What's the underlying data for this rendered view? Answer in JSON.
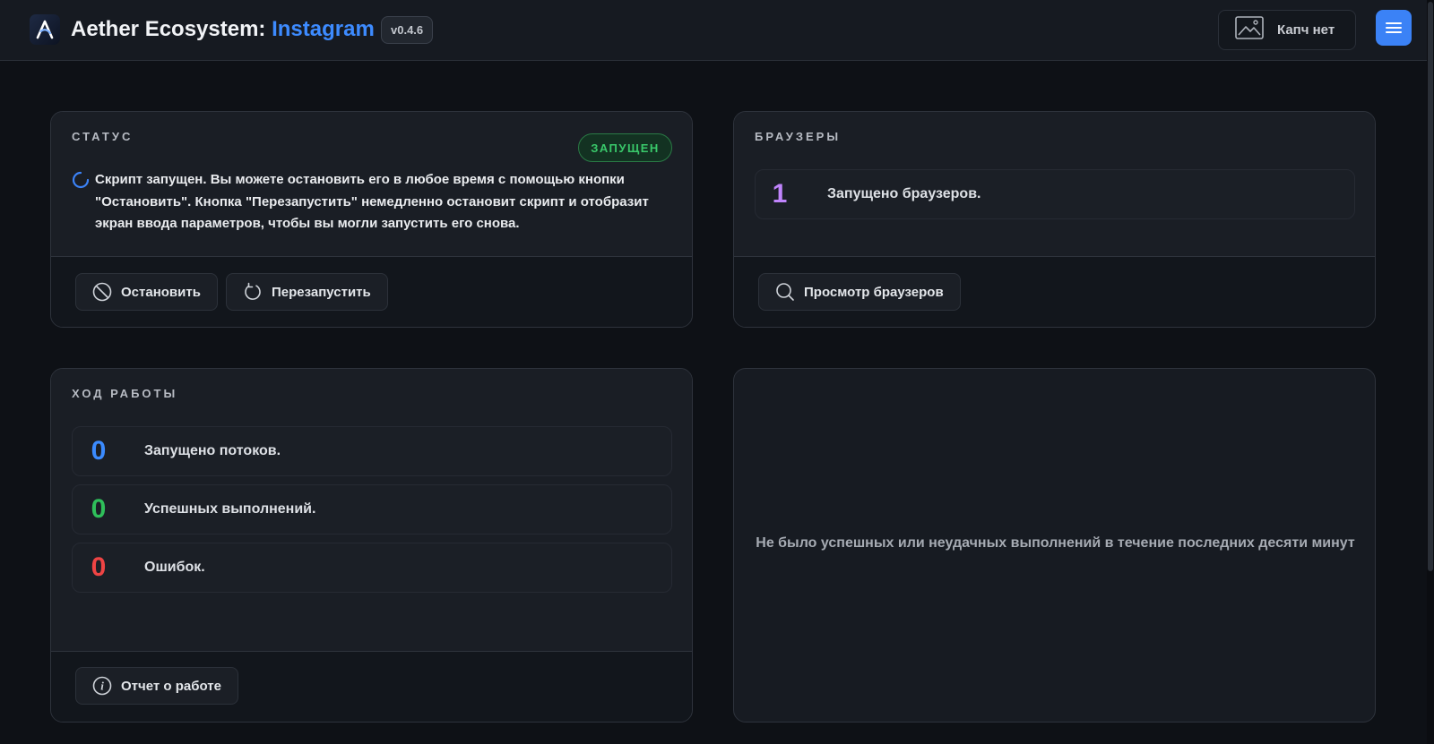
{
  "header": {
    "title_main": "Aether Ecosystem: ",
    "title_accent": "Instagram",
    "version": "v0.4.6",
    "captcha_label": "Капч нет"
  },
  "status_card": {
    "heading": "СТАТУС",
    "badge": "ЗАПУЩЕН",
    "message": "Скрипт запущен. Вы можете остановить его в любое время с помощью кнопки \"Остановить\". Кнопка \"Перезапустить\" немедленно остановит скрипт и отобразит экран ввода параметров, чтобы вы могли запустить его снова.",
    "stop_label": "Остановить",
    "restart_label": "Перезапустить"
  },
  "browsers_card": {
    "heading": "БРАУЗЕРЫ",
    "count": "1",
    "count_label": "Запущено браузеров.",
    "view_label": "Просмотр браузеров"
  },
  "progress_card": {
    "heading": "ХОД РАБОТЫ",
    "stats": [
      {
        "value": "0",
        "label": "Запущено потоков.",
        "color": "#3b8bff"
      },
      {
        "value": "0",
        "label": "Успешных выполнений.",
        "color": "#2fbf5a"
      },
      {
        "value": "0",
        "label": "Ошибок.",
        "color": "#ef4444"
      }
    ],
    "report_label": "Отчет о работе"
  },
  "activity_card": {
    "empty_message": "Не было успешных или неудачных выполнений в течение последних десяти минут"
  },
  "colors": {
    "accent": "#3b82f6",
    "badge_green": "#2fbf5a",
    "browser_count": "#c084fc"
  },
  "icons": {
    "logo": "aether-logo-icon",
    "captcha": "image-icon",
    "menu": "hamburger-icon",
    "spinner": "spinner-icon",
    "stop": "ban-icon",
    "restart": "rotate-icon",
    "search": "search-icon",
    "info": "info-icon"
  }
}
